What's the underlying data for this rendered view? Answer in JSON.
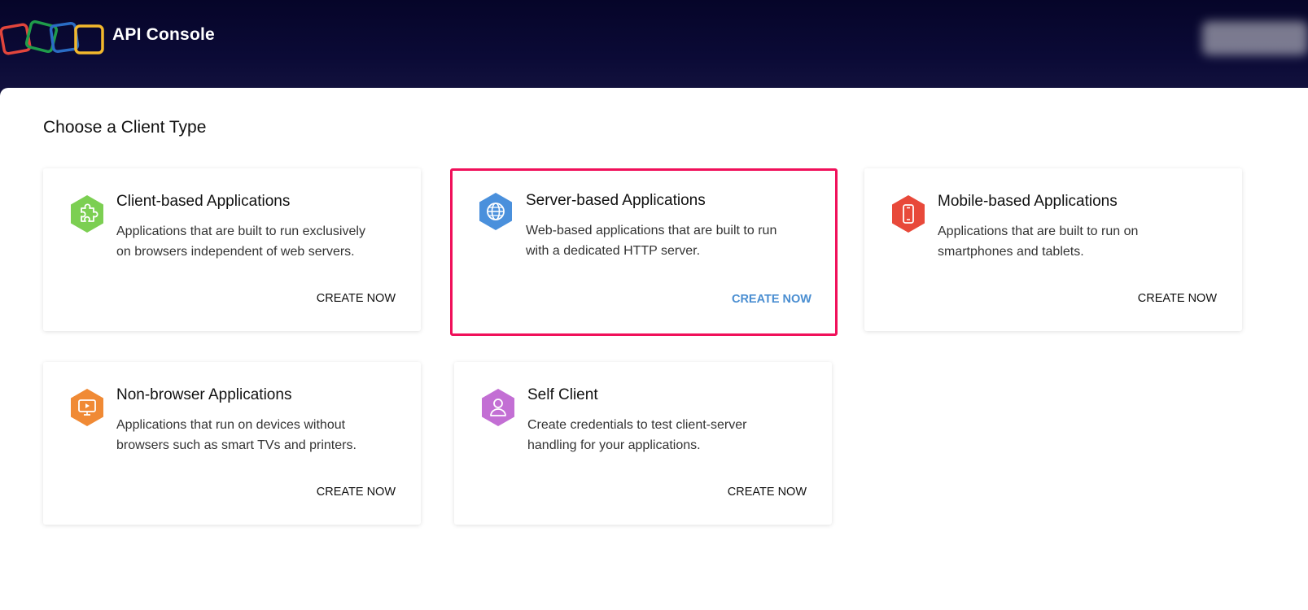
{
  "header": {
    "title": "API Console",
    "logo_icon": "zoho-logo-icon"
  },
  "page": {
    "title": "Choose a Client Type"
  },
  "cards": [
    {
      "title": "Client-based Applications",
      "description": "Applications that are built to run exclusively on browsers independent of web servers.",
      "action": "CREATE NOW",
      "icon": "puzzle-icon",
      "icon_color": "#7ccf52",
      "selected": false
    },
    {
      "title": "Server-based Applications",
      "description": "Web-based applications that are built to run with a dedicated HTTP server.",
      "action": "CREATE NOW",
      "icon": "globe-icon",
      "icon_color": "#4a90dc",
      "selected": true
    },
    {
      "title": "Mobile-based Applications",
      "description": "Applications that are built to run on smartphones and tablets.",
      "action": "CREATE NOW",
      "icon": "mobile-icon",
      "icon_color": "#e8493a",
      "selected": false
    },
    {
      "title": "Non-browser Applications",
      "description": "Applications that run on devices without browsers such as smart TVs and printers.",
      "action": "CREATE NOW",
      "icon": "tv-icon",
      "icon_color": "#f08a35",
      "selected": false
    },
    {
      "title": "Self Client",
      "description": "Create credentials to test client-server handling for your applications.",
      "action": "CREATE NOW",
      "icon": "user-icon",
      "icon_color": "#c36fd4",
      "selected": false
    }
  ],
  "colors": {
    "header_bg": "#060529",
    "selected_border": "#f0105a",
    "selected_action": "#4a8ed1"
  }
}
